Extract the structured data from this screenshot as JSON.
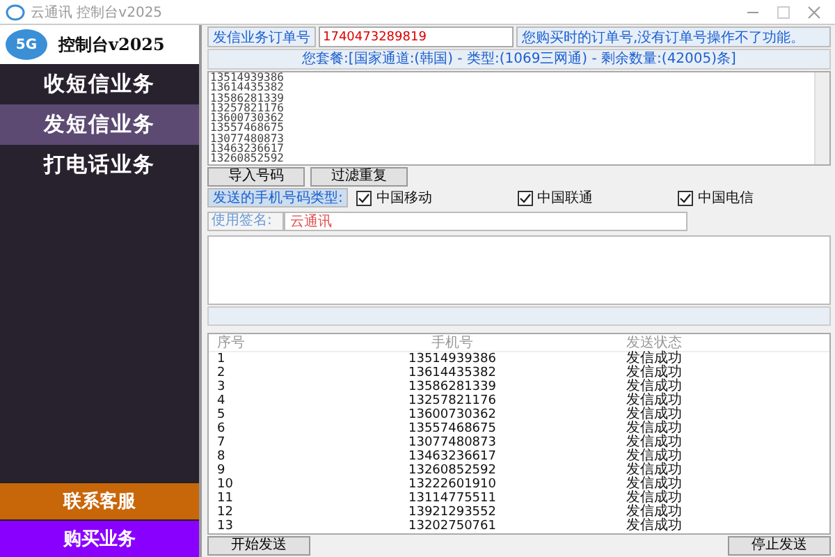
{
  "window": {
    "title": "云通讯 控制台v2025"
  },
  "sidebar": {
    "logo_badge": "5G",
    "logo_title": "控制台v2025",
    "items": [
      {
        "label": "收短信业务",
        "selected": false
      },
      {
        "label": "发短信业务",
        "selected": true
      },
      {
        "label": "打电话业务",
        "selected": false
      }
    ],
    "bottom_buttons": [
      {
        "label": "联系客服",
        "color": "#c8660a"
      },
      {
        "label": "购买业务",
        "color": "#8a00ff"
      }
    ]
  },
  "order": {
    "label": "发信业务订单号",
    "value": "1740473289819",
    "hint": "您购买时的订单号,没有订单号操作不了功能。"
  },
  "package": "您套餐:[国家通道:(韩国) - 类型:(1069三网通) - 剩余数量:(42005)条]",
  "numbers": [
    "13514939386",
    "13614435382",
    "13586281339",
    "13257821176",
    "13600730362",
    "13557468675",
    "13077480873",
    "13463236617",
    "13260852592"
  ],
  "number_buttons": [
    "导入号码",
    "过滤重复"
  ],
  "carrier_label": "发送的手机号码类型:",
  "carriers": [
    {
      "label": "中国移动",
      "checked": true
    },
    {
      "label": "中国联通",
      "checked": true
    },
    {
      "label": "中国电信",
      "checked": true
    }
  ],
  "signature": {
    "label": "使用签名:",
    "value": "云通讯"
  },
  "table": {
    "columns": [
      "序号",
      "手机号",
      "发送状态"
    ],
    "rows": [
      [
        "1",
        "13514939386",
        "发信成功"
      ],
      [
        "2",
        "13614435382",
        "发信成功"
      ],
      [
        "3",
        "13586281339",
        "发信成功"
      ],
      [
        "4",
        "13257821176",
        "发信成功"
      ],
      [
        "5",
        "13600730362",
        "发信成功"
      ],
      [
        "6",
        "13557468675",
        "发信成功"
      ],
      [
        "7",
        "13077480873",
        "发信成功"
      ],
      [
        "8",
        "13463236617",
        "发信成功"
      ],
      [
        "9",
        "13260852592",
        "发信成功"
      ],
      [
        "10",
        "13222601910",
        "发信成功"
      ],
      [
        "11",
        "13114775511",
        "发信成功"
      ],
      [
        "12",
        "13921293552",
        "发信成功"
      ],
      [
        "13",
        "13202750761",
        "发信成功"
      ]
    ]
  },
  "actions": [
    "开始发送",
    "停止发送"
  ]
}
